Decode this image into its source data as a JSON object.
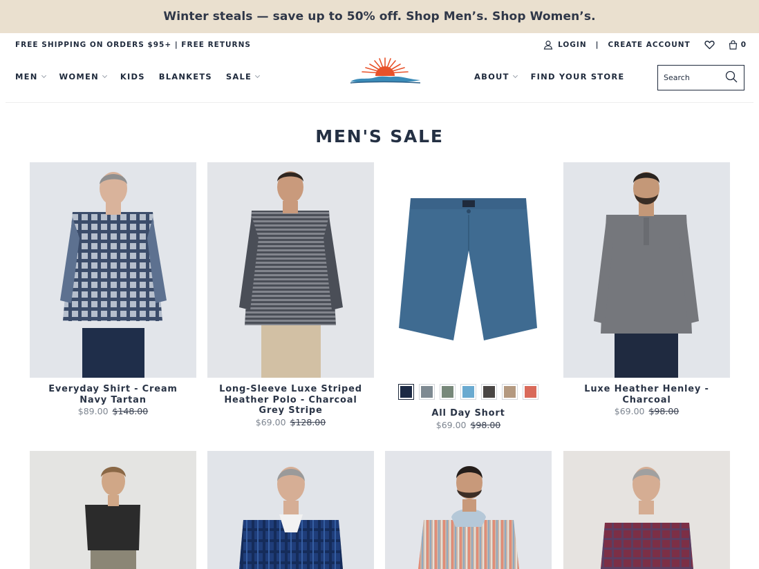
{
  "banner": {
    "text": "Winter steals — save up to 50% off. Shop Men’s. Shop Women’s."
  },
  "utility": {
    "shipping": "FREE SHIPPING ON ORDERS $95+ | FREE RETURNS",
    "login": "LOGIN",
    "separator": "|",
    "create_account": "CREATE ACCOUNT",
    "cart_count": "0"
  },
  "nav": {
    "left": [
      {
        "label": "MEN",
        "dropdown": true
      },
      {
        "label": "WOMEN",
        "dropdown": true
      },
      {
        "label": "KIDS",
        "dropdown": false
      },
      {
        "label": "BLANKETS",
        "dropdown": false
      },
      {
        "label": "SALE",
        "dropdown": true
      }
    ],
    "right": [
      {
        "label": "ABOUT",
        "dropdown": true
      },
      {
        "label": "FIND YOUR STORE",
        "dropdown": false
      }
    ]
  },
  "search": {
    "placeholder": "Search"
  },
  "page": {
    "title": "MEN'S SALE"
  },
  "products": [
    {
      "name": "Everyday Shirt - Cream Navy Tartan",
      "price": "$89.00",
      "compare_price": "$148.00"
    },
    {
      "name": "Long-Sleeve Luxe Striped Heather Polo - Charcoal Grey Stripe",
      "price": "$69.00",
      "compare_price": "$128.00"
    },
    {
      "name": "All Day Short",
      "price": "$69.00",
      "compare_price": "$98.00",
      "swatches": [
        "#1c2a44",
        "#7e8a92",
        "#77887a",
        "#6aaad0",
        "#4a4644",
        "#b49980",
        "#d96a5a"
      ]
    },
    {
      "name": "Luxe Heather Henley - Charcoal",
      "price": "$69.00",
      "compare_price": "$98.00"
    }
  ],
  "colors": {
    "banner_bg": "#eae0cf",
    "text": "#1f2a3c",
    "price_sale": "#7d8590",
    "logo_orange": "#e8522a",
    "logo_blue": "#3a8bb8"
  },
  "icons": [
    "user-icon",
    "heart-icon",
    "bag-icon",
    "search-icon",
    "chevron-down-icon"
  ]
}
